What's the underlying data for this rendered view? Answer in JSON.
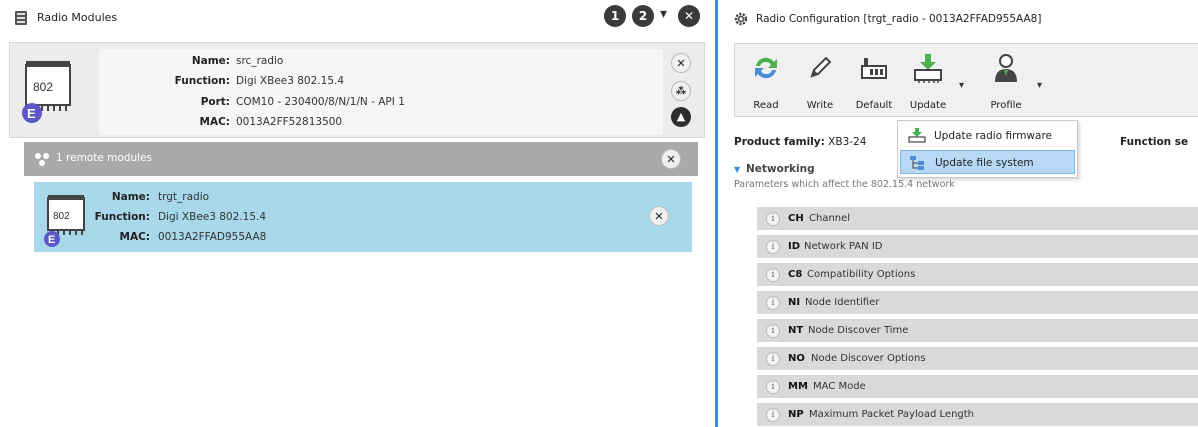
{
  "left_panel": {
    "title": "Radio Modules",
    "header_buttons": [
      "1",
      "2"
    ],
    "local_module": {
      "chip_label": "802",
      "badge": "E",
      "name_label": "Name:",
      "name": "src_radio",
      "function_label": "Function:",
      "function": "Digi XBee3 802.15.4",
      "port_label": "Port:",
      "port": "COM10 - 230400/8/N/1/N - API 1",
      "mac_label": "MAC:",
      "mac": "0013A2FF52813500"
    },
    "remote_bar": {
      "text": "1 remote modules"
    },
    "remote_module": {
      "chip_label": "802",
      "badge": "E",
      "name_label": "Name:",
      "name": "trgt_radio",
      "function_label": "Function:",
      "function": "Digi XBee3 802.15.4",
      "mac_label": "MAC:",
      "mac": "0013A2FFAD955AA8"
    }
  },
  "right_panel": {
    "title": "Radio Configuration [trgt_radio - 0013A2FFAD955AA8]",
    "toolbar": {
      "read": "Read",
      "write": "Write",
      "default": "Default",
      "update": "Update",
      "profile": "Profile"
    },
    "product_family_label": "Product family:",
    "product_family": "XB3-24",
    "function_set_label": "Function se",
    "update_menu": {
      "items": [
        "Update radio firmware",
        "Update file system"
      ]
    },
    "section": {
      "name": "Networking",
      "description": "Parameters which affect the 802.15.4 network"
    },
    "parameters": [
      {
        "code": "CH",
        "name": "Channel"
      },
      {
        "code": "ID",
        "name": "Network PAN ID"
      },
      {
        "code": "C8",
        "name": "Compatibility Options"
      },
      {
        "code": "NI",
        "name": "Node Identifier"
      },
      {
        "code": "NT",
        "name": "Node Discover Time"
      },
      {
        "code": "NO",
        "name": "Node Discover Options"
      },
      {
        "code": "MM",
        "name": "MAC Mode"
      },
      {
        "code": "NP",
        "name": "Maximum Packet Payload Length"
      }
    ]
  },
  "colors": {
    "divider": "#3d8fd1",
    "remote_card": "#a8d8ea",
    "badge": "#5b57c9",
    "menu_highlight": "#b7d9f5",
    "update_green": "#4caf50"
  }
}
